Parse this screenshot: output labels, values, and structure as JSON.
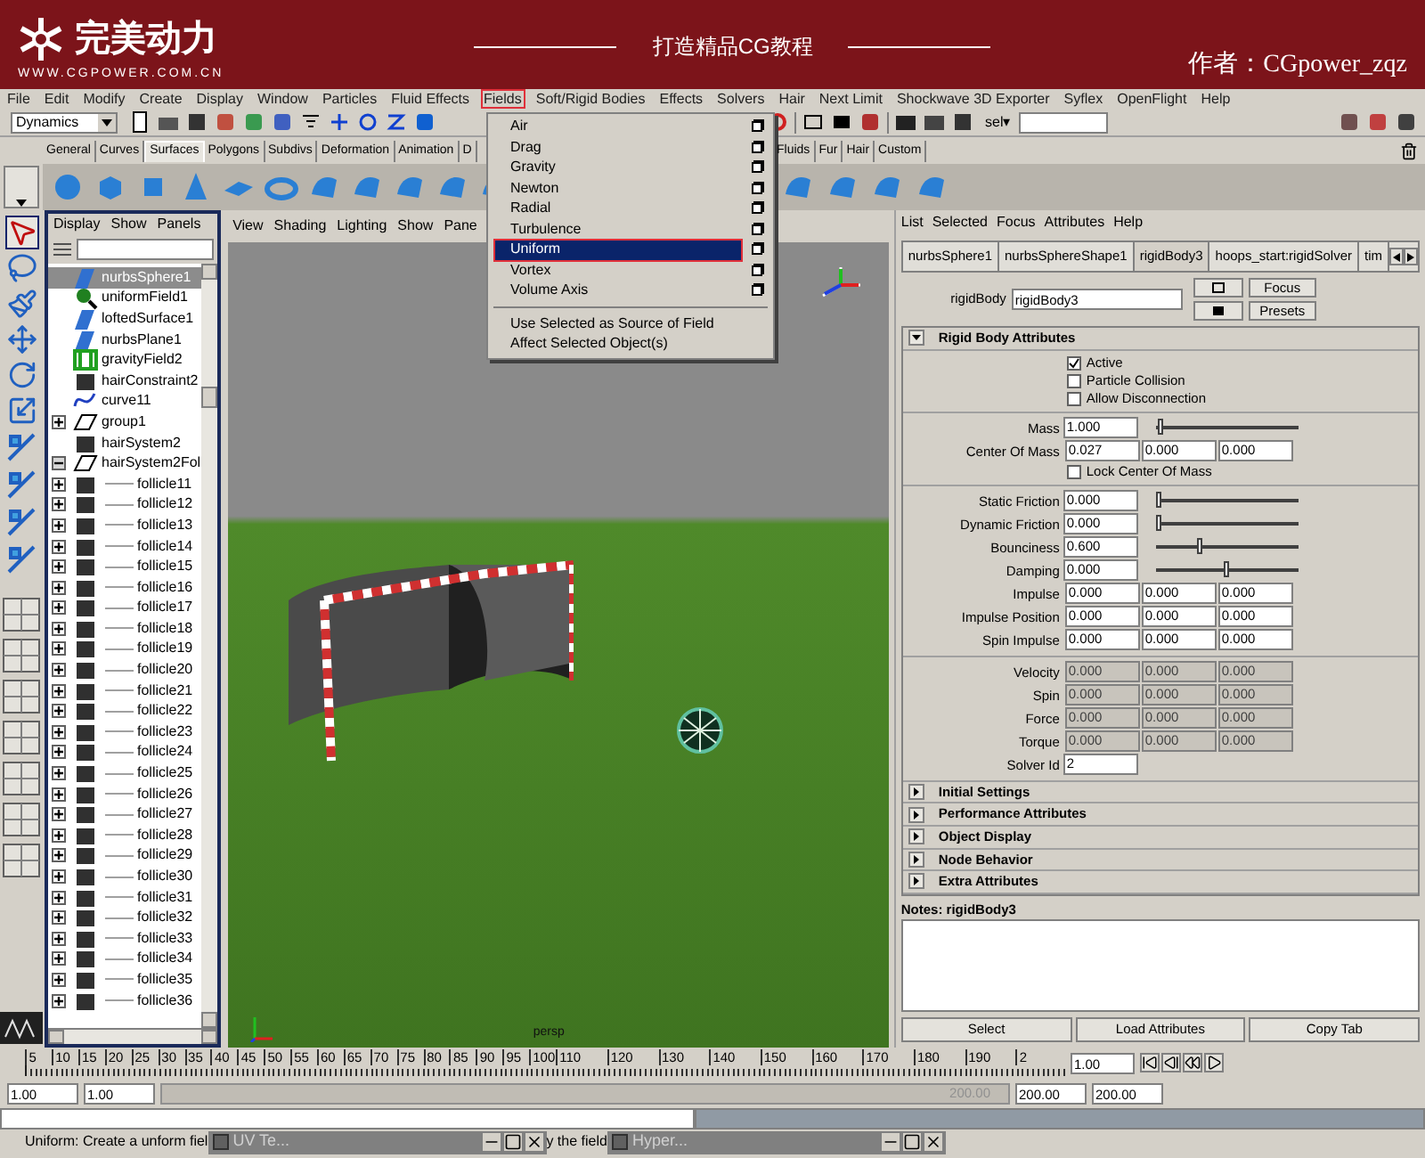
{
  "banner": {
    "logo_text": "完美动力",
    "url": "WWW.CGPOWER.COM.CN",
    "slogan": "打造精品CG教程",
    "author": "作者：CGpower_zqz"
  },
  "menu_bar": [
    {
      "label": "File",
      "selected": false
    },
    {
      "label": "Edit",
      "selected": false
    },
    {
      "label": "Modify",
      "selected": false
    },
    {
      "label": "Create",
      "selected": false
    },
    {
      "label": "Display",
      "selected": false
    },
    {
      "label": "Window",
      "selected": false
    },
    {
      "label": "Particles",
      "selected": false
    },
    {
      "label": "Fluid Effects",
      "selected": false
    },
    {
      "label": "Fields",
      "selected": true
    },
    {
      "label": "Soft/Rigid Bodies",
      "selected": false
    },
    {
      "label": "Effects",
      "selected": false
    },
    {
      "label": "Solvers",
      "selected": false
    },
    {
      "label": "Hair",
      "selected": false
    },
    {
      "label": "Next Limit",
      "selected": false
    },
    {
      "label": "Shockwave 3D Exporter",
      "selected": false
    },
    {
      "label": "Syflex",
      "selected": false
    },
    {
      "label": "OpenFlight",
      "selected": false
    },
    {
      "label": "Help",
      "selected": false
    }
  ],
  "fields_menu": [
    {
      "label": "Air",
      "kind": "option",
      "selected": false
    },
    {
      "label": "Drag",
      "kind": "option",
      "selected": false
    },
    {
      "label": "Gravity",
      "kind": "option",
      "selected": false
    },
    {
      "label": "Newton",
      "kind": "option",
      "selected": false
    },
    {
      "label": "Radial",
      "kind": "option",
      "selected": false
    },
    {
      "label": "Turbulence",
      "kind": "option",
      "selected": false
    },
    {
      "label": "Uniform",
      "kind": "option",
      "selected": true
    },
    {
      "label": "Vortex",
      "kind": "option",
      "selected": false
    },
    {
      "label": "Volume Axis",
      "kind": "option",
      "selected": false
    },
    {
      "label": "Use Selected as Source of Field",
      "kind": "action",
      "selected": false
    },
    {
      "label": "Affect Selected Object(s)",
      "kind": "action",
      "selected": false
    }
  ],
  "toolbar": {
    "mode": "Dynamics",
    "selection_mask": "sel▾"
  },
  "shelf_tabs_left": [
    {
      "label": "General",
      "selected": false
    },
    {
      "label": "Curves",
      "selected": false
    },
    {
      "label": "Surfaces",
      "selected": true
    },
    {
      "label": "Polygons",
      "selected": false
    },
    {
      "label": "Subdivs",
      "selected": false
    },
    {
      "label": "Deformation",
      "selected": false
    },
    {
      "label": "Animation",
      "selected": false
    },
    {
      "label": "D",
      "selected": false
    }
  ],
  "shelf_tabs_right": [
    {
      "label": "Fluids",
      "selected": false
    },
    {
      "label": "Fur",
      "selected": false
    },
    {
      "label": "Hair",
      "selected": false
    },
    {
      "label": "Custom",
      "selected": false
    }
  ],
  "outliner": {
    "menus": [
      "Display",
      "Show",
      "Panels"
    ],
    "items": [
      {
        "name": "nurbsSphere1",
        "kind": "surface",
        "selected": true
      },
      {
        "name": "uniformField1",
        "kind": "field",
        "selected": false
      },
      {
        "name": "loftedSurface1",
        "kind": "surface",
        "selected": false
      },
      {
        "name": "nurbsPlane1",
        "kind": "surface",
        "selected": false
      },
      {
        "name": "gravityField2",
        "kind": "gravity",
        "selected": false
      },
      {
        "name": "hairConstraint2",
        "kind": "hair",
        "selected": false
      },
      {
        "name": "curve11",
        "kind": "curve",
        "selected": false
      },
      {
        "name": "group1",
        "kind": "group",
        "selected": false,
        "has_children": true,
        "expanded": false
      },
      {
        "name": "hairSystem2",
        "kind": "hair",
        "selected": false
      },
      {
        "name": "hairSystem2Fol",
        "kind": "group",
        "selected": false,
        "has_children": true,
        "expanded": true,
        "children": [
          {
            "name": "follicle11",
            "kind": "hair",
            "selected": false,
            "has_children": true,
            "expanded": false
          },
          {
            "name": "follicle12",
            "kind": "hair",
            "selected": false,
            "has_children": true,
            "expanded": false
          },
          {
            "name": "follicle13",
            "kind": "hair",
            "selected": false,
            "has_children": true,
            "expanded": false
          },
          {
            "name": "follicle14",
            "kind": "hair",
            "selected": false,
            "has_children": true,
            "expanded": false
          },
          {
            "name": "follicle15",
            "kind": "hair",
            "selected": false,
            "has_children": true,
            "expanded": false
          },
          {
            "name": "follicle16",
            "kind": "hair",
            "selected": false,
            "has_children": true,
            "expanded": false
          },
          {
            "name": "follicle17",
            "kind": "hair",
            "selected": false,
            "has_children": true,
            "expanded": false
          },
          {
            "name": "follicle18",
            "kind": "hair",
            "selected": false,
            "has_children": true,
            "expanded": false
          },
          {
            "name": "follicle19",
            "kind": "hair",
            "selected": false,
            "has_children": true,
            "expanded": false
          },
          {
            "name": "follicle20",
            "kind": "hair",
            "selected": false,
            "has_children": true,
            "expanded": false
          },
          {
            "name": "follicle21",
            "kind": "hair",
            "selected": false,
            "has_children": true,
            "expanded": false
          },
          {
            "name": "follicle22",
            "kind": "hair",
            "selected": false,
            "has_children": true,
            "expanded": false
          },
          {
            "name": "follicle23",
            "kind": "hair",
            "selected": false,
            "has_children": true,
            "expanded": false
          },
          {
            "name": "follicle24",
            "kind": "hair",
            "selected": false,
            "has_children": true,
            "expanded": false
          },
          {
            "name": "follicle25",
            "kind": "hair",
            "selected": false,
            "has_children": true,
            "expanded": false
          },
          {
            "name": "follicle26",
            "kind": "hair",
            "selected": false,
            "has_children": true,
            "expanded": false
          },
          {
            "name": "follicle27",
            "kind": "hair",
            "selected": false,
            "has_children": true,
            "expanded": false
          },
          {
            "name": "follicle28",
            "kind": "hair",
            "selected": false,
            "has_children": true,
            "expanded": false
          },
          {
            "name": "follicle29",
            "kind": "hair",
            "selected": false,
            "has_children": true,
            "expanded": false
          },
          {
            "name": "follicle30",
            "kind": "hair",
            "selected": false,
            "has_children": true,
            "expanded": false
          },
          {
            "name": "follicle31",
            "kind": "hair",
            "selected": false,
            "has_children": true,
            "expanded": false
          },
          {
            "name": "follicle32",
            "kind": "hair",
            "selected": false,
            "has_children": true,
            "expanded": false
          },
          {
            "name": "follicle33",
            "kind": "hair",
            "selected": false,
            "has_children": true,
            "expanded": false
          },
          {
            "name": "follicle34",
            "kind": "hair",
            "selected": false,
            "has_children": true,
            "expanded": false
          },
          {
            "name": "follicle35",
            "kind": "hair",
            "selected": false,
            "has_children": true,
            "expanded": false
          },
          {
            "name": "follicle36",
            "kind": "hair",
            "selected": false,
            "has_children": true,
            "expanded": false
          }
        ]
      }
    ]
  },
  "viewport": {
    "menus": [
      "View",
      "Shading",
      "Lighting",
      "Show",
      "Pane"
    ],
    "camera_label": "persp"
  },
  "attribute_editor": {
    "menus": [
      "List",
      "Selected",
      "Focus",
      "Attributes",
      "Help"
    ],
    "tabs": [
      {
        "label": "nurbsSphere1",
        "selected": false
      },
      {
        "label": "nurbsSphereShape1",
        "selected": false
      },
      {
        "label": "rigidBody3",
        "selected": true
      },
      {
        "label": "hoops_start:rigidSolver",
        "selected": false
      },
      {
        "label": "tim",
        "selected": false
      }
    ],
    "node_label": "rigidBody",
    "node_value": "rigidBody3",
    "buttons": [
      "Focus",
      "Presets"
    ],
    "section": {
      "title": "Rigid Body Attributes",
      "expanded": true,
      "groups": [
        [
          {
            "kind": "checkbox",
            "label": "Active",
            "checked": true
          },
          {
            "kind": "checkbox",
            "label": "Particle Collision",
            "checked": false
          },
          {
            "kind": "checkbox",
            "label": "Allow Disconnection",
            "checked": false
          }
        ],
        [
          {
            "kind": "slider",
            "label": "Mass",
            "value": "1.000",
            "level": 0.02
          },
          {
            "kind": "vector",
            "label": "Center Of Mass",
            "values": [
              "0.027",
              "0.000",
              "0.000"
            ],
            "disabled": false
          },
          {
            "kind": "checkbox",
            "label": "Lock Center Of Mass",
            "checked": false
          }
        ],
        [
          {
            "kind": "slider",
            "label": "Static Friction",
            "value": "0.000",
            "level": 0.0
          },
          {
            "kind": "slider",
            "label": "Dynamic Friction",
            "value": "0.000",
            "level": 0.0
          },
          {
            "kind": "slider",
            "label": "Bounciness",
            "value": "0.600",
            "level": 0.3
          },
          {
            "kind": "slider",
            "label": "Damping",
            "value": "0.000",
            "level": 0.5
          },
          {
            "kind": "vector",
            "label": "Impulse",
            "values": [
              "0.000",
              "0.000",
              "0.000"
            ],
            "disabled": false
          },
          {
            "kind": "vector",
            "label": "Impulse Position",
            "values": [
              "0.000",
              "0.000",
              "0.000"
            ],
            "disabled": false
          },
          {
            "kind": "vector",
            "label": "Spin Impulse",
            "values": [
              "0.000",
              "0.000",
              "0.000"
            ],
            "disabled": false
          }
        ],
        [
          {
            "kind": "vector",
            "label": "Velocity",
            "values": [
              "0.000",
              "0.000",
              "0.000"
            ],
            "disabled": true
          },
          {
            "kind": "vector",
            "label": "Spin",
            "values": [
              "0.000",
              "0.000",
              "0.000"
            ],
            "disabled": true
          },
          {
            "kind": "vector",
            "label": "Force",
            "values": [
              "0.000",
              "0.000",
              "0.000"
            ],
            "disabled": true
          },
          {
            "kind": "vector",
            "label": "Torque",
            "values": [
              "0.000",
              "0.000",
              "0.000"
            ],
            "disabled": true
          },
          {
            "kind": "field",
            "label": "Solver Id",
            "value": "2"
          }
        ]
      ]
    },
    "collapsed_sections": [
      {
        "title": "Initial Settings",
        "expanded": false
      },
      {
        "title": "Performance Attributes",
        "expanded": false
      },
      {
        "title": "Object Display",
        "expanded": false
      },
      {
        "title": "Node Behavior",
        "expanded": false
      },
      {
        "title": "Extra Attributes",
        "expanded": false
      }
    ],
    "notes_label": "Notes: rigidBody3",
    "bottom_buttons": [
      "Select",
      "Load Attributes",
      "Copy Tab"
    ]
  },
  "time_slider": {
    "ticks": [
      "5",
      "10",
      "15",
      "20",
      "25",
      "30",
      "35",
      "40",
      "45",
      "50",
      "55",
      "60",
      "65",
      "70",
      "75",
      "80",
      "85",
      "90",
      "95",
      "100",
      "110",
      "120",
      "130",
      "140",
      "150",
      "160",
      "170",
      "180",
      "190",
      "2"
    ],
    "current_frame": "1.00"
  },
  "range_slider": {
    "start": "1.00",
    "playback_start": "1.00",
    "bar_end": "200.00",
    "playback_end": "200.00",
    "end": "200.00"
  },
  "help_line": {
    "segments": [
      "Uniform: Create a unform fiel",
      "y the field"
    ],
    "minimized_windows": [
      "UV Te...",
      "Hyper..."
    ]
  }
}
